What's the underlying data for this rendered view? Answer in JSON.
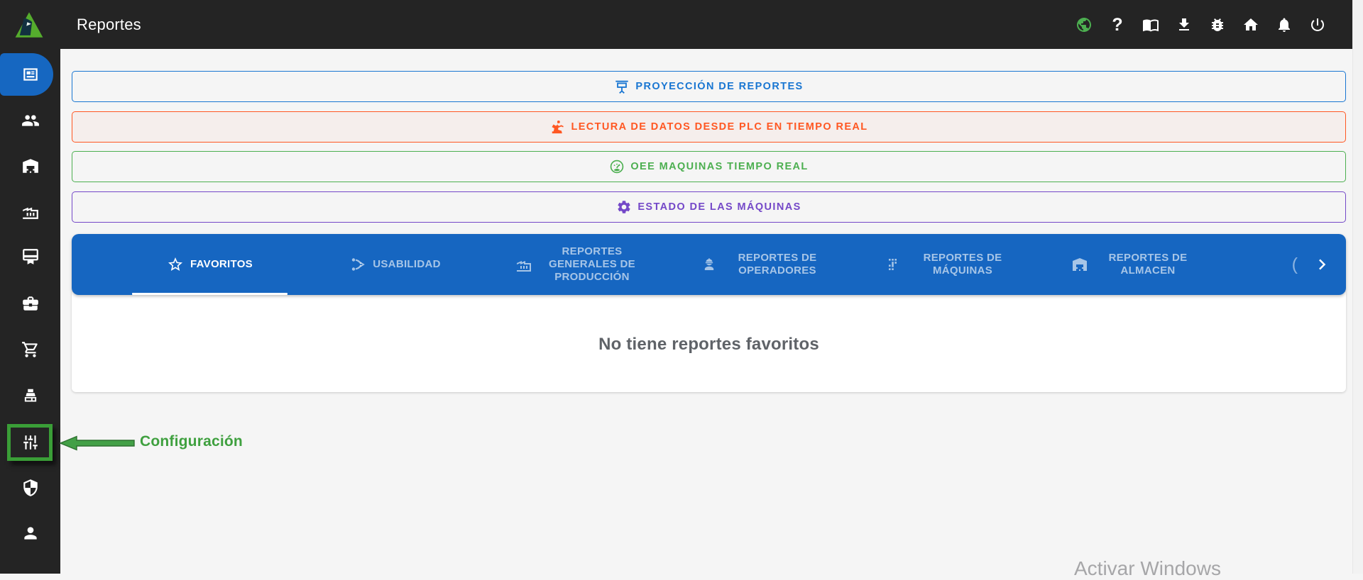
{
  "colors": {
    "chrome_dark": "#242424",
    "tabbar_blue": "#1666c1",
    "accent_blue": "#1976d2",
    "accent_orange": "#ff5722",
    "accent_green": "#4caf50",
    "accent_purple": "#7448c8",
    "annotation_green": "#3fa03f",
    "page_background": "#f5f5f5"
  },
  "header": {
    "title": "Reportes",
    "logo": "triangle-logo",
    "icons": [
      "globe-icon",
      "help-icon",
      "manual-book-icon",
      "download-icon",
      "bug-icon",
      "home-icon",
      "notifications-icon",
      "power-icon"
    ]
  },
  "sidebar": {
    "items": [
      {
        "icon": "reports-article-icon",
        "active": true
      },
      {
        "icon": "people-icon",
        "active": false
      },
      {
        "icon": "warehouse-icon",
        "active": false
      },
      {
        "icon": "factory-icon",
        "active": false
      },
      {
        "icon": "card-membership-icon",
        "active": false
      },
      {
        "icon": "briefcase-icon",
        "active": false
      },
      {
        "icon": "shopping-cart-icon",
        "active": false
      },
      {
        "icon": "cash-register-icon",
        "active": false
      },
      {
        "icon": "tune-sliders-icon",
        "active": false
      },
      {
        "icon": "shield-icon",
        "active": false
      },
      {
        "icon": "person-icon",
        "active": false
      }
    ]
  },
  "action_buttons": [
    {
      "label": "PROYECCIÓN DE REPORTES",
      "icon": "projection-screen-icon",
      "color": "#1976d2"
    },
    {
      "label": "LECTURA DE DATOS DESDE PLC EN TIEMPO REAL",
      "icon": "robot-arm-icon",
      "color": "#ff5722"
    },
    {
      "label": "OEE MAQUINAS TIEMPO REAL",
      "icon": "gauge-icon",
      "color": "#4caf50"
    },
    {
      "label": "ESTADO DE LAS MÁQUINAS",
      "icon": "gear-icon",
      "color": "#7448c8"
    }
  ],
  "tabs": {
    "items": [
      {
        "label": "FAVORITOS",
        "icon": "star-icon",
        "active": true
      },
      {
        "label": "USABILIDAD",
        "icon": "usability-icon",
        "active": false
      },
      {
        "label": "REPORTES GENERALES DE PRODUCCIÓN",
        "icon": "factory-icon",
        "active": false
      },
      {
        "label": "REPORTES DE OPERADORES",
        "icon": "operator-icon",
        "active": false
      },
      {
        "label": "REPORTES DE MÁQUINAS",
        "icon": "machine-icon",
        "active": false
      },
      {
        "label": "REPORTES DE ALMACEN",
        "icon": "warehouse-icon",
        "active": false
      }
    ],
    "overflow_text": "(",
    "scroll_icon": "chevron-right-icon"
  },
  "favorites_panel": {
    "empty_message": "No tiene reportes favoritos"
  },
  "annotation": {
    "label": "Configuración",
    "arrow_icon": "left-arrow-annotation"
  },
  "watermark": {
    "line1": "Activar Windows"
  }
}
